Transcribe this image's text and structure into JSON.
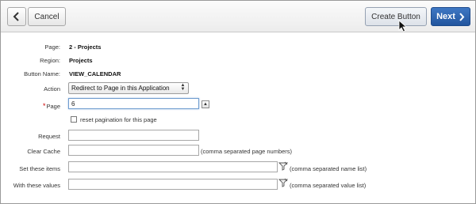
{
  "toolbar": {
    "back_icon": "chevron-left-icon",
    "cancel_label": "Cancel",
    "create_label": "Create Button",
    "next_label": "Next",
    "next_icon": "chevron-right-icon"
  },
  "form": {
    "page": {
      "label": "Page:",
      "value": "2 - Projects"
    },
    "region": {
      "label": "Region:",
      "value": "Projects"
    },
    "button_name": {
      "label": "Button Name:",
      "value": "VIEW_CALENDAR"
    },
    "action": {
      "label": "Action",
      "value": "Redirect to Page in this Application"
    },
    "target_page": {
      "label": "Page",
      "required": "*",
      "value": "6"
    },
    "reset_pagination": {
      "label": "reset pagination for this page",
      "checked": false
    },
    "request": {
      "label": "Request",
      "value": ""
    },
    "clear_cache": {
      "label": "Clear Cache",
      "value": "",
      "hint": "(comma separated page numbers)"
    },
    "set_items": {
      "label": "Set these items",
      "value": "",
      "hint": "(comma separated name list)"
    },
    "with_values": {
      "label": "With these values",
      "value": "",
      "hint": "(comma separated value list)"
    }
  },
  "colors": {
    "primary": "#2a5fa8",
    "required": "#cc0000",
    "focus": "#6f9ccf"
  }
}
